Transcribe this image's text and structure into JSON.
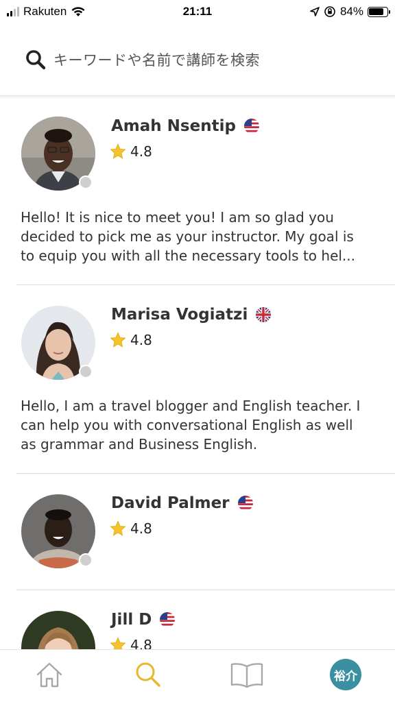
{
  "status_bar": {
    "carrier": "Rakuten",
    "time": "21:11",
    "battery": "84%",
    "battery_level": 0.84
  },
  "search": {
    "placeholder": "キーワードや名前で講師を検索"
  },
  "teachers": [
    {
      "name": "Amah Nsentip",
      "flag": "us-flag",
      "rating": "4.8",
      "bio": [
        "Hello! It is nice to meet you! I am so glad you",
        "decided to pick me as your instructor. My goal is",
        "to equip you with all the necessary tools to hel..."
      ]
    },
    {
      "name": "Marisa Vogiatzi",
      "flag": "uk-flag",
      "rating": "4.8",
      "bio": [
        "Hello, I am a travel blogger and English teacher. I",
        "can help you with conversational English as well",
        "as grammar and Business English."
      ]
    },
    {
      "name": "David Palmer",
      "flag": "us-flag",
      "rating": "4.8",
      "bio": []
    },
    {
      "name": "Jill D",
      "flag": "us-flag",
      "rating": "4.8",
      "bio": []
    }
  ],
  "tab_bar": {
    "tabs": [
      "home-icon",
      "search-icon",
      "book-icon",
      "profile-avatar"
    ],
    "active": "search-icon",
    "profile_initials": "裕介",
    "active_color": "#e8b92a",
    "inactive_color": "#a8a8a8"
  }
}
